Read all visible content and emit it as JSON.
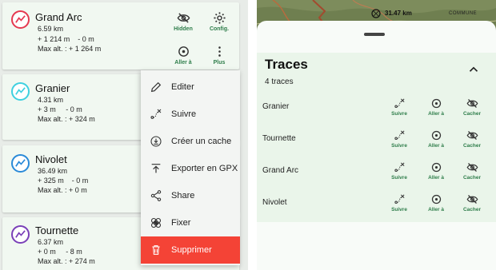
{
  "tracks": [
    {
      "name": "Grand Arc",
      "distance": "6.59 km",
      "elevation": "+ 1 214 m    - 0 m",
      "altitude": "Max alt. : + 1 264 m",
      "color": "#e53950"
    },
    {
      "name": "Granier",
      "distance": "4.31 km",
      "elevation": "+ 3 m     - 0 m",
      "altitude": "Max alt. : + 324 m",
      "color": "#3fd0e0"
    },
    {
      "name": "Nivolet",
      "distance": "36.49 km",
      "elevation": "+ 325 m    - 0 m",
      "altitude": "Max alt. : + 0 m",
      "color": "#2a8ad8"
    },
    {
      "name": "Tournette",
      "distance": "6.37 km",
      "elevation": "+ 0 m     - 8 m",
      "altitude": "Max alt. : + 274 m",
      "color": "#7a3fb8"
    }
  ],
  "card_actions": {
    "hidden": "Hidden",
    "config": "Config.",
    "goto": "Aller à",
    "more": "Plus"
  },
  "menu": {
    "items": [
      {
        "label": "Editer",
        "icon": "pencil-icon"
      },
      {
        "label": "Suivre",
        "icon": "route-icon"
      },
      {
        "label": "Créer un cache",
        "icon": "download-icon"
      },
      {
        "label": "Exporter en GPX",
        "icon": "upload-icon"
      },
      {
        "label": "Share",
        "icon": "share-icon"
      },
      {
        "label": "Fixer",
        "icon": "bandage-icon"
      },
      {
        "label": "Supprimer",
        "icon": "trash-icon"
      }
    ]
  },
  "map": {
    "scale": "31.47 km",
    "place": "COMMUNE"
  },
  "traces": {
    "title": "Traces",
    "count": "4 traces",
    "rows": [
      "Granier",
      "Tournette",
      "Grand Arc",
      "Nivolet"
    ],
    "actions": {
      "follow": "Suivre",
      "goto": "Aller à",
      "hide": "Cacher"
    }
  },
  "colors": {
    "accent": "#2e7d4a",
    "danger": "#f44336"
  }
}
